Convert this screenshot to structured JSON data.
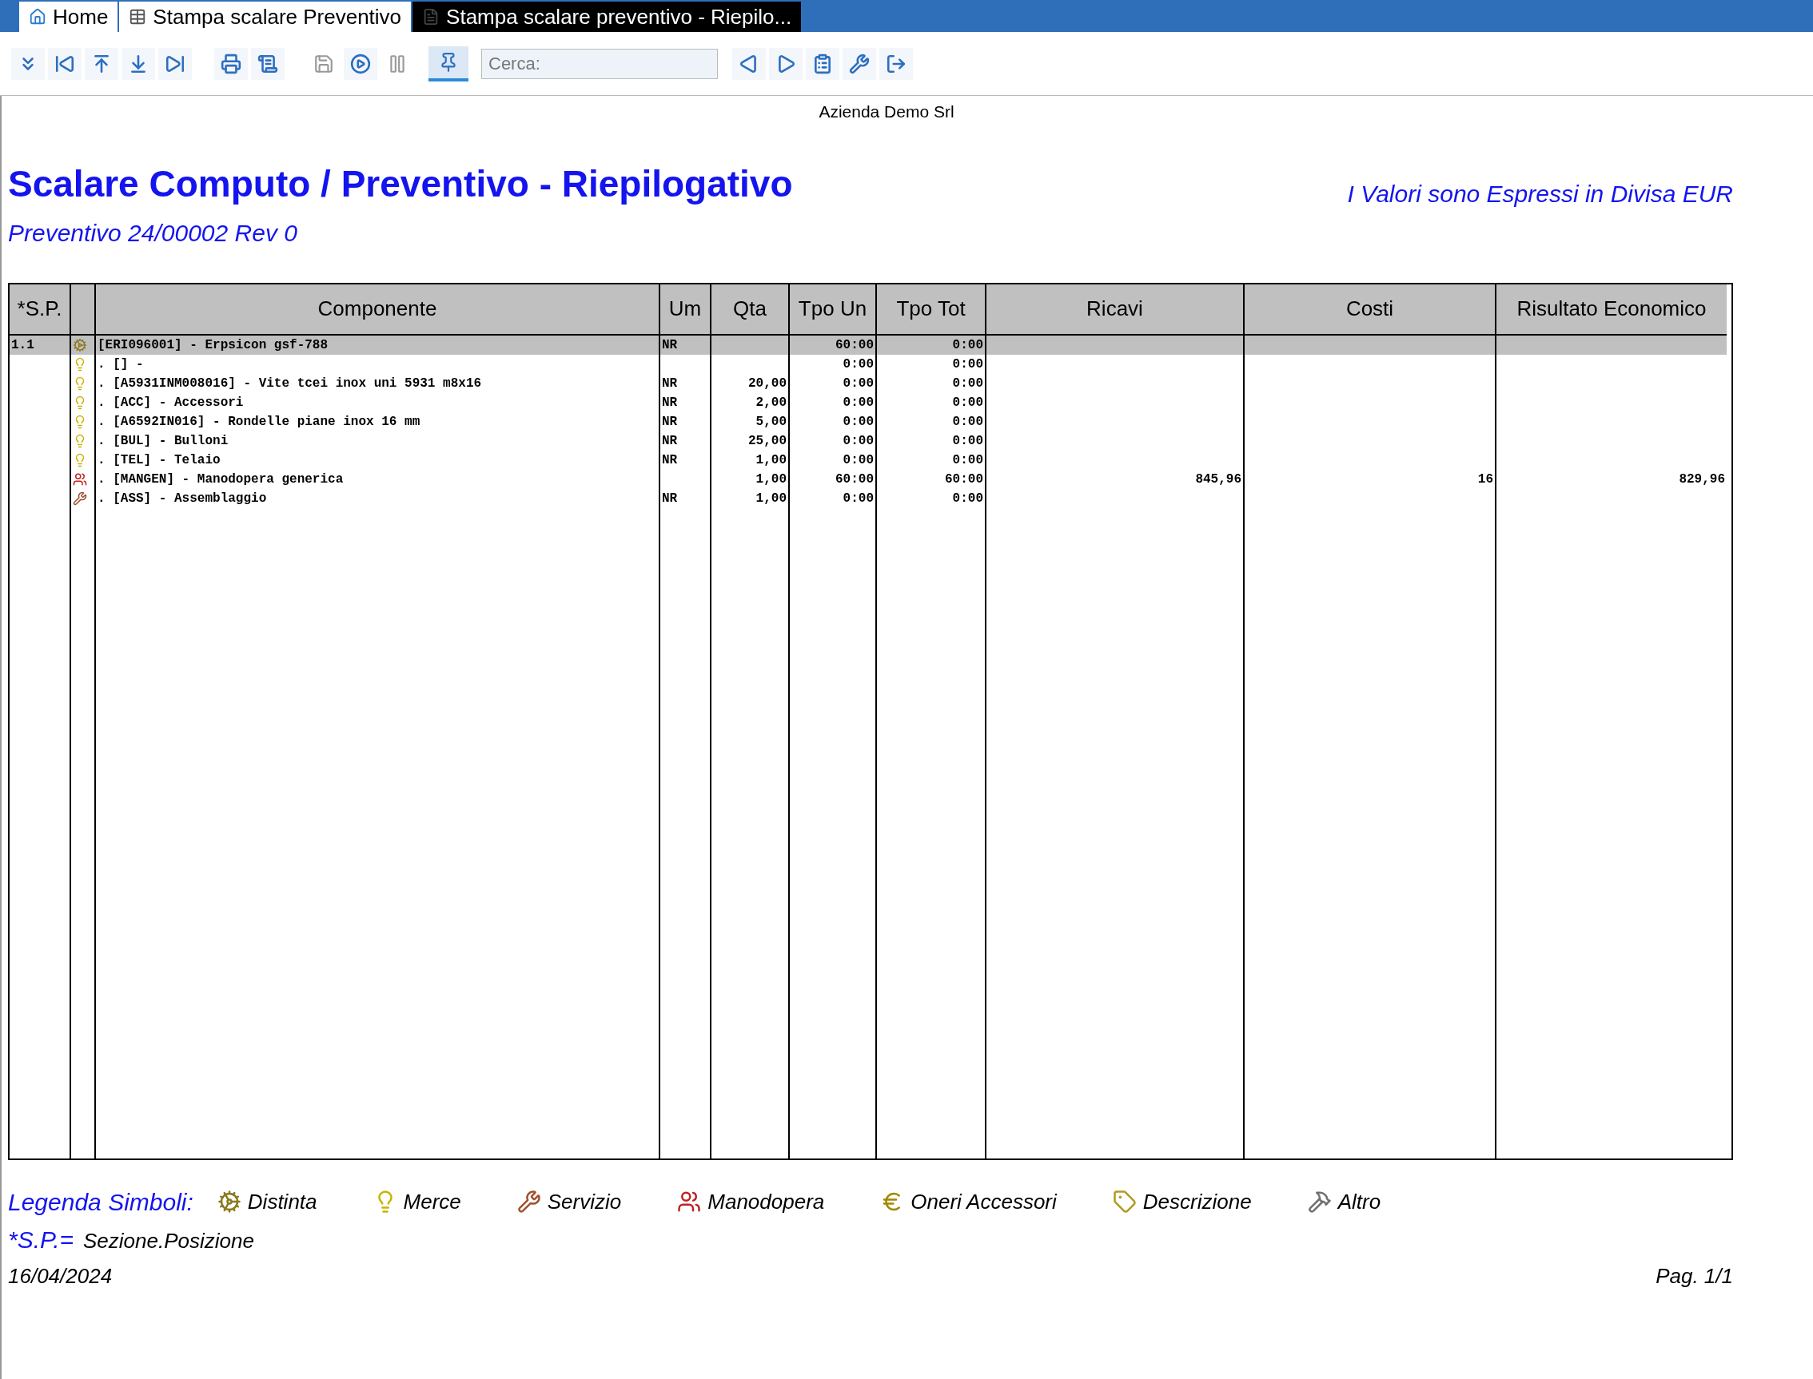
{
  "tabs": [
    {
      "label": "Home",
      "selected": false,
      "kind": "home"
    },
    {
      "label": "Stampa scalare Preventivo",
      "selected": false,
      "kind": "form"
    },
    {
      "label": "Stampa scalare preventivo - Riepilo...",
      "selected": true,
      "kind": "report"
    }
  ],
  "search": {
    "placeholder": "Cerca:"
  },
  "report": {
    "company": "Azienda Demo Srl",
    "title": "Scalare Computo / Preventivo - Riepilogativo",
    "subtitle": "Preventivo 24/00002 Rev 0",
    "currency_note": "I Valori sono Espressi in Divisa EUR",
    "table": {
      "columns": [
        "*S.P.",
        "",
        "Componente",
        "Um",
        "Qta",
        "Tpo Un",
        "Tpo Tot",
        "Ricavi",
        "Costi",
        "Risultato Economico"
      ],
      "rows": [
        {
          "sp": "1.1",
          "kind": "distinta",
          "selected": true,
          "componente": "[ERI096001] - Erpsicon gsf-788",
          "um": "NR",
          "qta": "",
          "tpo_un": "60:00",
          "tpo_tot": "0:00",
          "ricavi": "",
          "costi": "",
          "risultato": ""
        },
        {
          "sp": "",
          "kind": "merce",
          "selected": false,
          "componente": ". [] -",
          "um": "",
          "qta": "",
          "tpo_un": "0:00",
          "tpo_tot": "0:00",
          "ricavi": "",
          "costi": "",
          "risultato": ""
        },
        {
          "sp": "",
          "kind": "merce",
          "selected": false,
          "componente": ". [A5931INM008016] - Vite tcei inox uni 5931 m8x16",
          "um": "NR",
          "qta": "20,00",
          "tpo_un": "0:00",
          "tpo_tot": "0:00",
          "ricavi": "",
          "costi": "",
          "risultato": ""
        },
        {
          "sp": "",
          "kind": "merce",
          "selected": false,
          "componente": ". [ACC] - Accessori",
          "um": "NR",
          "qta": "2,00",
          "tpo_un": "0:00",
          "tpo_tot": "0:00",
          "ricavi": "",
          "costi": "",
          "risultato": ""
        },
        {
          "sp": "",
          "kind": "merce",
          "selected": false,
          "componente": ". [A6592IN016] - Rondelle piane inox 16 mm",
          "um": "NR",
          "qta": "5,00",
          "tpo_un": "0:00",
          "tpo_tot": "0:00",
          "ricavi": "",
          "costi": "",
          "risultato": ""
        },
        {
          "sp": "",
          "kind": "merce",
          "selected": false,
          "componente": ". [BUL] - Bulloni",
          "um": "NR",
          "qta": "25,00",
          "tpo_un": "0:00",
          "tpo_tot": "0:00",
          "ricavi": "",
          "costi": "",
          "risultato": ""
        },
        {
          "sp": "",
          "kind": "merce",
          "selected": false,
          "componente": ". [TEL] - Telaio",
          "um": "NR",
          "qta": "1,00",
          "tpo_un": "0:00",
          "tpo_tot": "0:00",
          "ricavi": "",
          "costi": "",
          "risultato": ""
        },
        {
          "sp": "",
          "kind": "manodopera",
          "selected": false,
          "componente": ". [MANGEN] - Manodopera generica",
          "um": "",
          "qta": "1,00",
          "tpo_un": "60:00",
          "tpo_tot": "60:00",
          "ricavi": "845,96",
          "costi": "16",
          "risultato": "829,96"
        },
        {
          "sp": "",
          "kind": "servizio",
          "selected": false,
          "componente": ". [ASS] - Assemblaggio",
          "um": "NR",
          "qta": "1,00",
          "tpo_un": "0:00",
          "tpo_tot": "0:00",
          "ricavi": "",
          "costi": "",
          "risultato": ""
        }
      ]
    },
    "legend": {
      "title": "Legenda Simboli:",
      "items": [
        {
          "kind": "distinta",
          "label": "Distinta"
        },
        {
          "kind": "merce",
          "label": "Merce"
        },
        {
          "kind": "servizio",
          "label": "Servizio"
        },
        {
          "kind": "manodopera",
          "label": "Manodopera"
        },
        {
          "kind": "oneri",
          "label": "Oneri Accessori"
        },
        {
          "kind": "descrizione",
          "label": "Descrizione"
        },
        {
          "kind": "altro",
          "label": "Altro"
        }
      ],
      "sp_key": "*S.P.=",
      "sp_value": "Sezione.Posizione"
    },
    "date": "16/04/2024",
    "page": "Pag. 1/1"
  }
}
